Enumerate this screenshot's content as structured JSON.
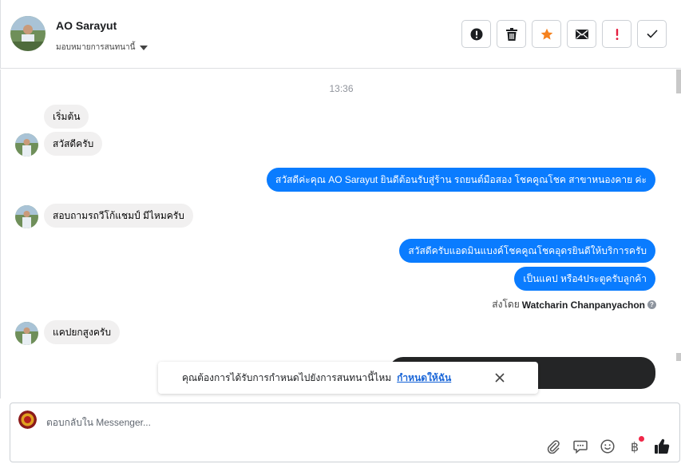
{
  "header": {
    "contact_name": "AO Sarayut",
    "assign_label": "มอบหมายการสนทนานี้",
    "actions": [
      {
        "name": "spam",
        "icon": "exclamation-circle-icon"
      },
      {
        "name": "delete",
        "icon": "trash-icon"
      },
      {
        "name": "star",
        "icon": "star-icon",
        "color": "#f5821f"
      },
      {
        "name": "mark-unread",
        "icon": "envelope-icon"
      },
      {
        "name": "follow-up",
        "icon": "exclamation-icon",
        "color": "#e41e3f"
      },
      {
        "name": "done",
        "icon": "check-icon"
      }
    ]
  },
  "chat": {
    "timestamp": "13:36",
    "messages": [
      {
        "from": "customer",
        "text": "เริ่มต้น"
      },
      {
        "from": "customer",
        "text": "สวัสดีครับ"
      },
      {
        "from": "page",
        "text": "สวัสดีค่ะคุณ AO Sarayut ยินดีต้อนรับสู่ร้าน รถยนต์มือสอง โชคคูณโชค สาขาหนองคาย ค่ะ"
      },
      {
        "from": "customer",
        "text": "สอบถามรถวีโก้แชมป์ มีไหมครับ"
      },
      {
        "from": "page",
        "text": "สวัสดีครับแอดมินแบงค์โชคคูณโชคอุดรยินดีให้บริการครับ"
      },
      {
        "from": "page",
        "text": "เป็นแคป หรือ4ประตูครับลูกค้า"
      },
      {
        "from": "customer",
        "text": "แคปยกสูงครับ"
      }
    ],
    "sent_by_prefix": "ส่งโดย",
    "sent_by_name": "Watcharin Chanpanyachon",
    "sent_by_help": "?"
  },
  "notice": {
    "text": "คุณต้องการได้รับการกำหนดไปยังการสนทนานี้ไหม",
    "link": "กำหนดให้ฉัน"
  },
  "composer": {
    "placeholder": "ตอบกลับใน Messenger...",
    "tools": [
      "paperclip-icon",
      "chat-bubble-icon",
      "smiley-icon",
      "baht-icon",
      "thumbs-up-icon"
    ],
    "baht_symbol": "฿"
  },
  "colors": {
    "outgoing_bubble": "#0a7cff",
    "incoming_bubble": "#f1f0f0",
    "accent_star": "#f5821f",
    "accent_red": "#e41e3f",
    "link": "#1a66d8"
  }
}
